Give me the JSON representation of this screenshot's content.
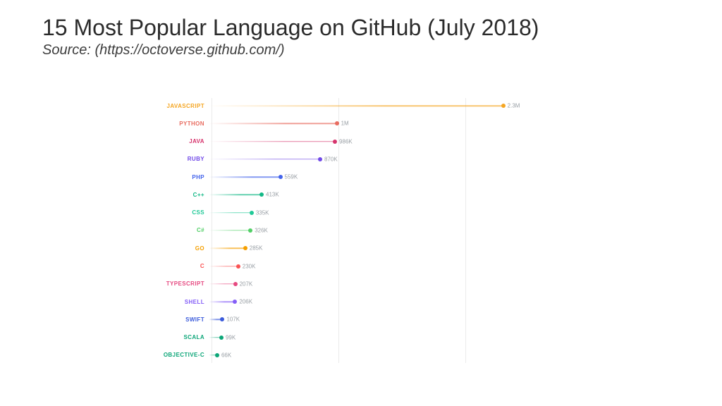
{
  "header": {
    "title": "15 Most Popular Language on GitHub (July 2018)",
    "subtitle": "Source: (https://octoverse.github.com/)"
  },
  "chart_data": {
    "type": "bar",
    "orientation": "horizontal",
    "style": "lollipop",
    "title": "",
    "xlabel": "",
    "ylabel": "",
    "x_unit": "repositories",
    "xlim": [
      0,
      2500000
    ],
    "gridlines_x": [
      0,
      1000000,
      2000000
    ],
    "categories": [
      "JAVASCRIPT",
      "PYTHON",
      "JAVA",
      "RUBY",
      "PHP",
      "C++",
      "CSS",
      "C#",
      "GO",
      "C",
      "TYPESCRIPT",
      "SHELL",
      "SWIFT",
      "SCALA",
      "OBJECTIVE-C"
    ],
    "values": [
      2300000,
      1000000,
      986000,
      870000,
      559000,
      413000,
      335000,
      326000,
      285000,
      230000,
      207000,
      206000,
      107000,
      99000,
      66000
    ],
    "value_labels": [
      "2.3M",
      "1M",
      "986K",
      "870K",
      "559K",
      "413K",
      "335K",
      "326K",
      "285K",
      "230K",
      "207K",
      "206K",
      "107K",
      "99K",
      "66K"
    ],
    "colors": [
      "#f5a623",
      "#e86c60",
      "#d6336c",
      "#7048e8",
      "#4263eb",
      "#12b886",
      "#20c997",
      "#51cf66",
      "#f59f00",
      "#fa5252",
      "#e64980",
      "#845ef7",
      "#3b5bdb",
      "#0ca678",
      "#0ca678"
    ]
  }
}
